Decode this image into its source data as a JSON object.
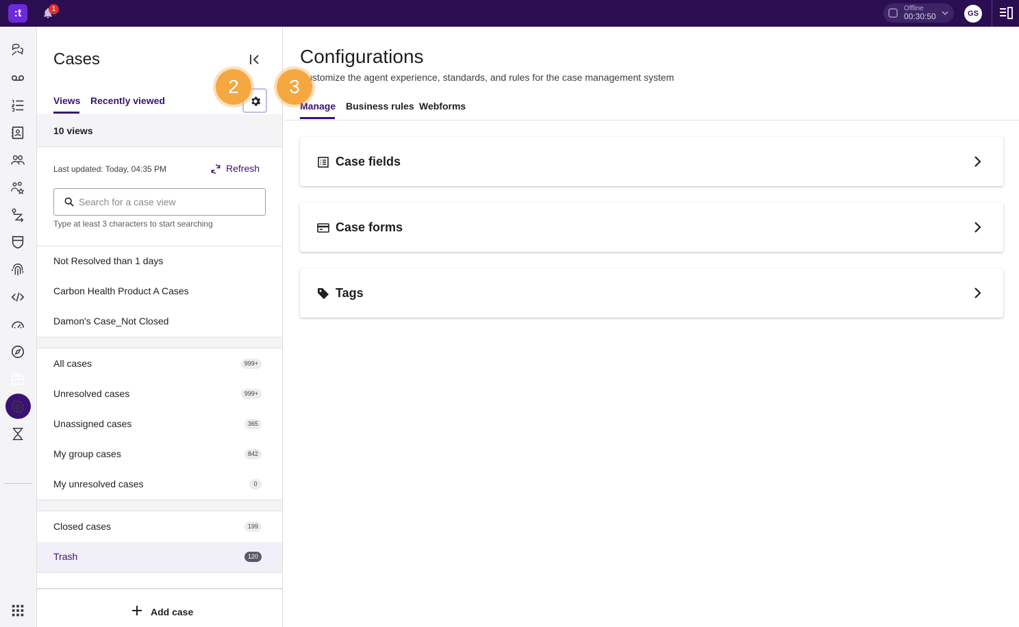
{
  "topbar": {
    "logo_text": ":t",
    "notification_count": "1",
    "status_label": "Offline",
    "status_timer": "00:30:50",
    "user_initials": "GS"
  },
  "rail": {
    "icons": [
      "chat-bubbles-icon",
      "voicemail-icon",
      "list-icon",
      "contacts-icon",
      "agents-icon",
      "skills-icon",
      "routing-icon",
      "shield-icon",
      "fingerprint-icon",
      "code-icon",
      "dashboard-gauge-icon",
      "compass-icon",
      "briefcase-icon",
      "settings-icon",
      "hourglass-icon",
      "apps-grid-icon"
    ],
    "active": "briefcase-icon"
  },
  "cases": {
    "title": "Cases",
    "tabs": [
      "Views",
      "Recently viewed"
    ],
    "active_tab": "Views",
    "views_count": "10 views",
    "last_updated": "Last updated:  Today, 04:35 PM",
    "refresh_label": "Refresh",
    "search_placeholder": "Search for a case view",
    "search_hint": "Type at least 3 characters to start searching",
    "custom_views": [
      {
        "label": "Not Resolved than 1 days"
      },
      {
        "label": "Carbon Health Product A Cases"
      },
      {
        "label": "Damon's Case_Not Closed"
      }
    ],
    "standard_views": [
      {
        "label": "All cases",
        "count": "999+"
      },
      {
        "label": "Unresolved cases",
        "count": "999+"
      },
      {
        "label": "Unassigned cases",
        "count": "365"
      },
      {
        "label": "My group cases",
        "count": "842"
      },
      {
        "label": "My unresolved cases",
        "count": "0"
      }
    ],
    "other_views": [
      {
        "label": "Closed cases",
        "count": "199"
      },
      {
        "label": "Trash",
        "count": "120",
        "selected": true
      }
    ],
    "add_case_label": "Add case"
  },
  "callouts": [
    "2",
    "3"
  ],
  "main": {
    "title": "Configurations",
    "subtitle": "Customize the agent experience, standards, and rules for the case management system",
    "tabs": [
      "Manage",
      "Business rules",
      "Webforms"
    ],
    "active_tab": "Manage",
    "cards": [
      {
        "title": "Case fields",
        "icon": "list-box-icon"
      },
      {
        "title": "Case forms",
        "icon": "form-icon"
      },
      {
        "title": "Tags",
        "icon": "tag-icon"
      }
    ]
  },
  "colors": {
    "topbar": "#2b0d52",
    "accent": "#3a1273",
    "callout": "#f5a742"
  }
}
